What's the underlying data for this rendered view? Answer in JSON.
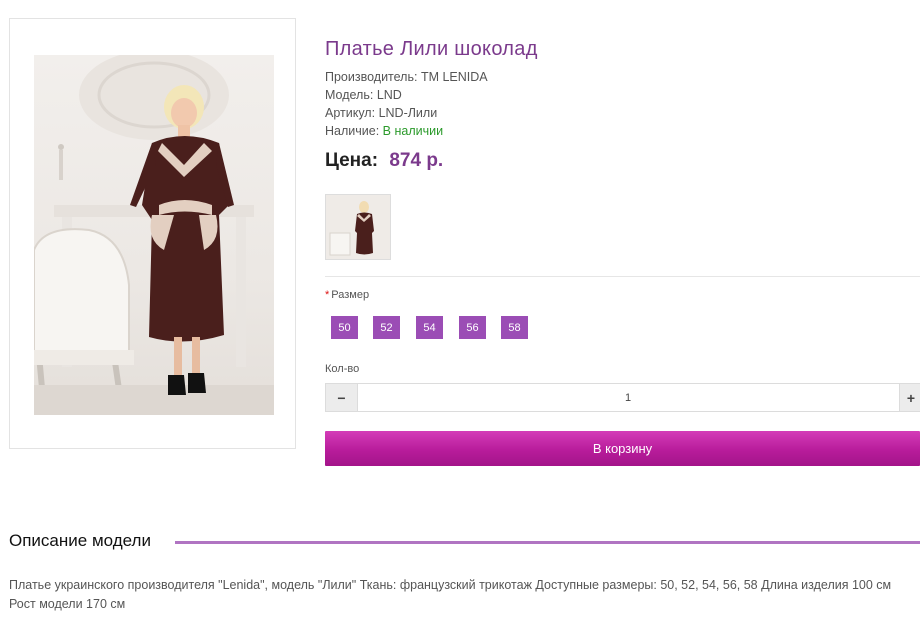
{
  "product": {
    "title": "Платье Лили шоколад",
    "manufacturer_label": "Производитель:",
    "manufacturer_value": "TM LENIDA",
    "model_label": "Модель:",
    "model_value": "LND",
    "sku_label": "Артикул:",
    "sku_value": "LND-Лили",
    "availability_label": "Наличие:",
    "availability_value": "В наличии",
    "price_label": "Цена:",
    "price_value": "874 р."
  },
  "options": {
    "required_mark": "*",
    "size_label": "Размер",
    "sizes": [
      "50",
      "52",
      "54",
      "56",
      "58"
    ]
  },
  "quantity": {
    "label": "Кол-во",
    "value": "1",
    "minus": "−",
    "plus": "+"
  },
  "cart": {
    "button_label": "В корзину"
  },
  "description": {
    "heading": "Описание модели",
    "text": "Платье украинского производителя \"Lenida\", модель \"Лили\" Ткань: французский трикотаж Доступные размеры: 50, 52, 54, 56, 58 Длина изделия 100 см Рост модели 170 см"
  },
  "colors": {
    "accent": "#7b3a8c",
    "size_button": "#9b4db5",
    "cart_button": "#b81c9b",
    "in_stock": "#2b9a2b",
    "heading_line": "#b074c2"
  }
}
